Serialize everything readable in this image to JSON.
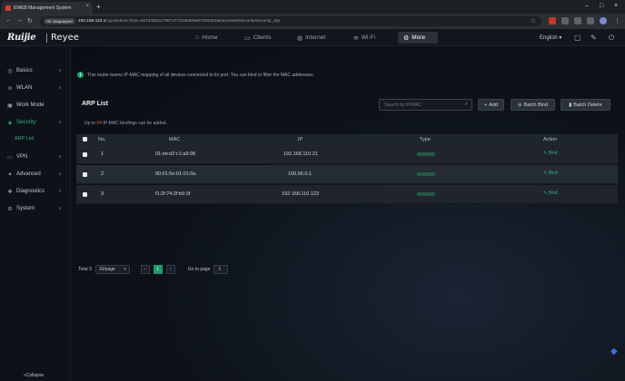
{
  "browser": {
    "tab_title": "EWEB Management System",
    "security_chip": "Не защищено",
    "url_host": "192.168.110.1",
    "url_path": "/cgi-bin/luci/;stok=a67d48d3179574773c8bd8ae57d8f45/admin/eweb/security/security_arp",
    "new_tab": "+",
    "tab_close": "×"
  },
  "header": {
    "logo_left": "Ruijie",
    "logo_right": "Reyee",
    "nav": [
      {
        "label": "Home",
        "icon": "home-icon"
      },
      {
        "label": "Clients",
        "icon": "clients-icon"
      },
      {
        "label": "Internet",
        "icon": "globe-icon"
      },
      {
        "label": "Wi-Fi",
        "icon": "wifi-icon"
      },
      {
        "label": "More",
        "icon": "gear-icon"
      }
    ],
    "language": "English"
  },
  "sidebar": {
    "items": [
      {
        "label": "Basics",
        "icon": "basics-icon"
      },
      {
        "label": "WLAN",
        "icon": "wlan-icon"
      },
      {
        "label": "Work Mode",
        "icon": "work-mode-icon"
      },
      {
        "label": "Security",
        "icon": "shield-icon"
      },
      {
        "label": "VPN",
        "icon": "vpn-icon"
      },
      {
        "label": "Advanced",
        "icon": "advanced-icon"
      },
      {
        "label": "Diagnostics",
        "icon": "diagnostics-icon"
      },
      {
        "label": "System",
        "icon": "system-icon"
      }
    ],
    "sub_item": "ARP List",
    "collapse_label": "Collapse"
  },
  "main": {
    "notice": "This router learns IP-MAC mapping of all devices connected to its port. You can bind or filter the MAC addresses.",
    "card_title": "ARP List",
    "search_placeholder": "Search by IP/MAC",
    "buttons": {
      "add": "Add",
      "batch_bind": "Batch Bind",
      "batch_delete": "Batch Delete"
    },
    "limit_prefix": "Up to",
    "limit_num": "64",
    "limit_suffix": "IP-MAC bindings can be added.",
    "columns": [
      "No.",
      "MAC",
      "IP",
      "Type",
      "Action"
    ],
    "rows": [
      {
        "no": "1",
        "mac": "01:eb:d2:c1:a9:98",
        "ip": "192.168.110.21",
        "action": "Bind"
      },
      {
        "no": "2",
        "mac": "00:01:5e:01:01:0a",
        "ip": "100.66.0.1",
        "action": "Bind"
      },
      {
        "no": "3",
        "mac": "f1:2f:74:2f:b9:3f",
        "ip": "192.168.110.123",
        "action": "Bind"
      }
    ],
    "pager": {
      "total_label": "Total 3",
      "page_size": "10/page",
      "current_page": "1",
      "goto_label": "Go to page",
      "goto_value": "1"
    }
  },
  "colors": {
    "accent": "#1d9b6c",
    "limit_number": "#e05a47"
  }
}
